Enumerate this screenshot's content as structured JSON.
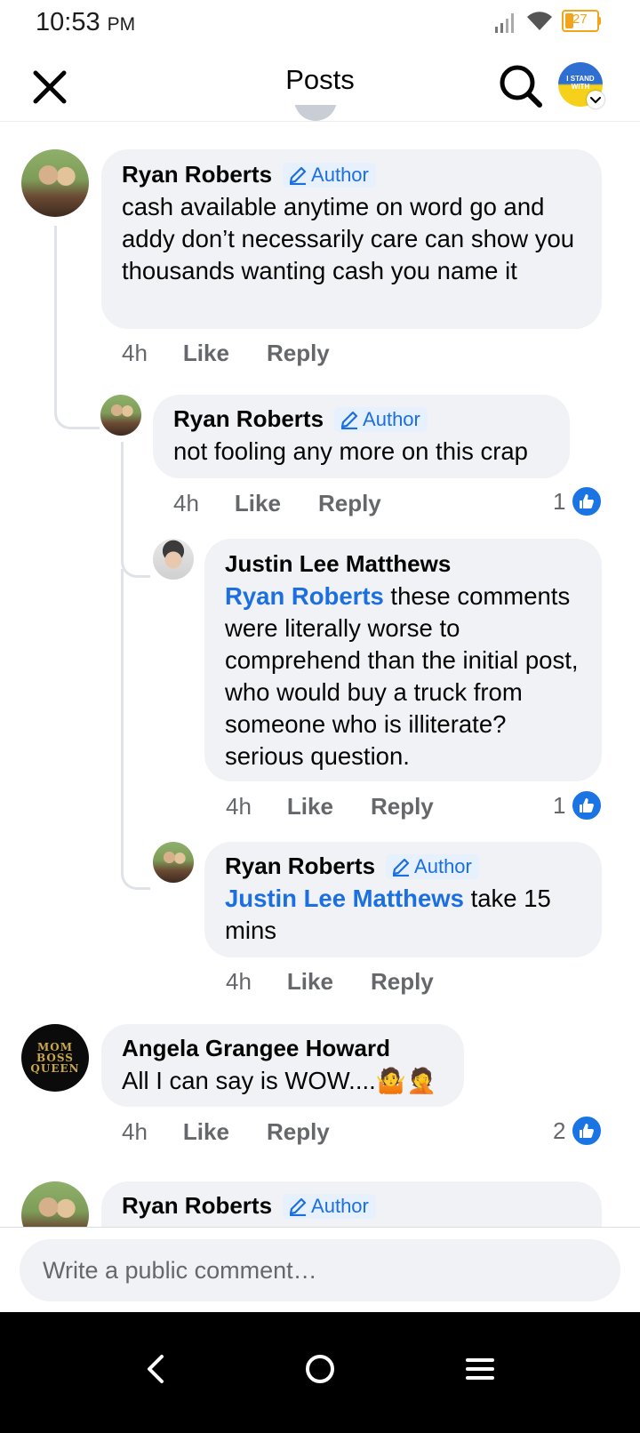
{
  "status_bar": {
    "time": "10:53",
    "ampm": "PM",
    "battery": "27"
  },
  "header": {
    "title": "Posts",
    "profile_text": "I STAND WITH"
  },
  "comments": [
    {
      "name": "Ryan Roberts",
      "badge": "Author",
      "text": "cash available anytime on word go and addy don’t necessarily care can show you thousands wanting cash you name it",
      "time": "4h",
      "like": "Like",
      "reply": "Reply"
    },
    {
      "name": "Ryan Roberts",
      "badge": "Author",
      "text": "not fooling any more on this crap",
      "time": "4h",
      "like": "Like",
      "reply": "Reply",
      "reactions": "1"
    },
    {
      "name": "Justin Lee Matthews",
      "mention": "Ryan Roberts",
      "text": " these comments were literally worse to comprehend than the initial post, who would buy a truck from someone who is illiterate? serious question.",
      "time": "4h",
      "like": "Like",
      "reply": "Reply",
      "reactions": "1"
    },
    {
      "name": "Ryan Roberts",
      "badge": "Author",
      "mention": "Justin Lee Matthews",
      "text": " take 15 mins",
      "time": "4h",
      "like": "Like",
      "reply": "Reply"
    },
    {
      "name": "Angela Grangee Howard",
      "avatar_text": "MOM BOSS QUEEN",
      "text": "All I can say is WOW....🤷🤦",
      "time": "4h",
      "like": "Like",
      "reply": "Reply",
      "reactions": "2"
    },
    {
      "name": "Ryan Roberts",
      "badge": "Author"
    }
  ],
  "composer": {
    "placeholder": "Write a public comment…"
  },
  "icons": [
    "close-icon",
    "search-icon",
    "chevron-down-icon",
    "pencil-icon",
    "thumbs-up-icon",
    "back-icon",
    "home-icon",
    "menu-icon",
    "signal-icon",
    "wifi-icon",
    "battery-icon"
  ],
  "colors": {
    "accent": "#1b74e4",
    "author_badge_bg": "#e7f0fd",
    "bubble_bg": "#f0f2f5",
    "battery": "#f2a41a"
  }
}
